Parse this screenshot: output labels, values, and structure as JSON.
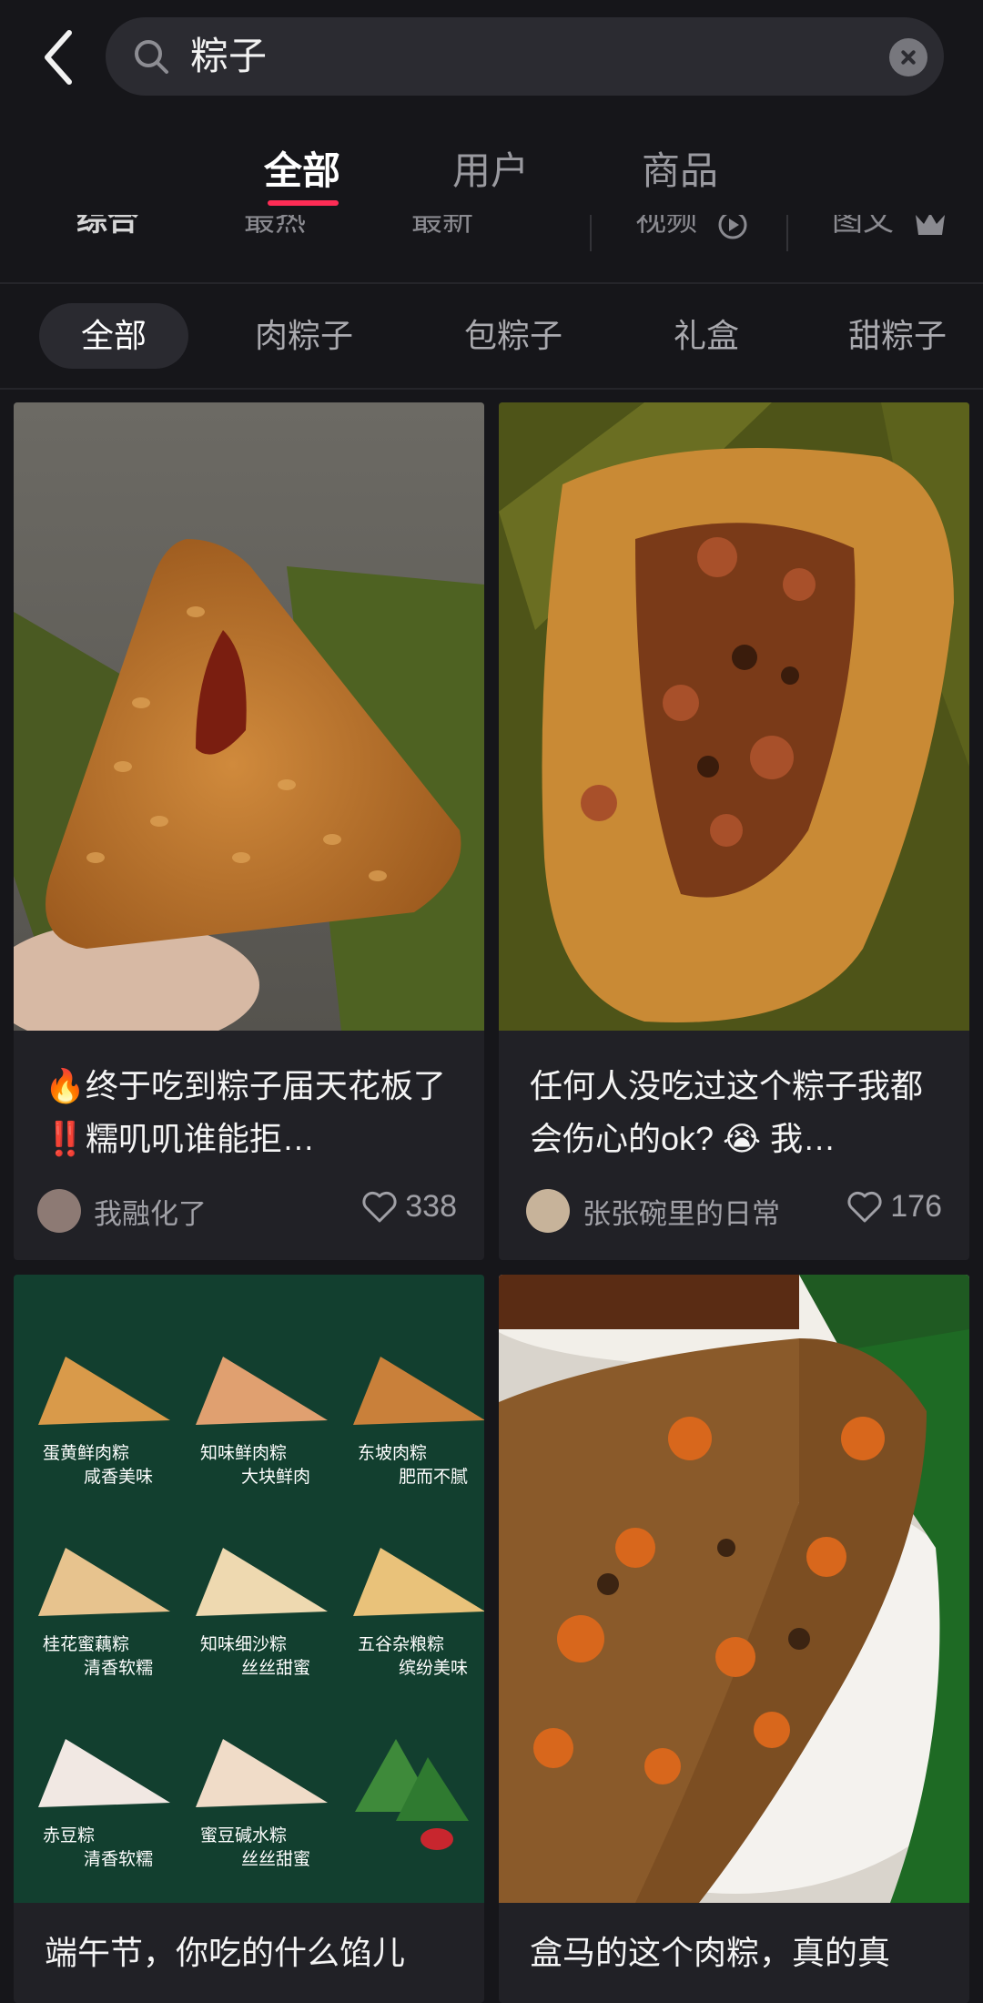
{
  "search": {
    "query": "粽子"
  },
  "tabs": [
    {
      "label": "全部",
      "active": true
    },
    {
      "label": "用户",
      "active": false
    },
    {
      "label": "商品",
      "active": false
    }
  ],
  "sort_options": [
    "综合",
    "最热",
    "最新",
    "视频",
    "图文"
  ],
  "filters": [
    "全部",
    "肉粽子",
    "包粽子",
    "礼盒",
    "甜粽子"
  ],
  "posts": [
    {
      "title": "🔥终于吃到粽子届天花板了 ‼️糯叽叽谁能拒…",
      "author": "我融化了",
      "likes": "338"
    },
    {
      "title": "任何人没吃过这个粽子我都会伤心的ok? 😭 我…",
      "author": "张张碗里的日常",
      "likes": "176"
    },
    {
      "title": "端午节，你吃的什么馅儿",
      "menu": [
        {
          "name": "蛋黄鲜肉粽",
          "desc": "咸香美味"
        },
        {
          "name": "知味鲜肉粽",
          "desc": "大块鲜肉"
        },
        {
          "name": "东坡肉粽",
          "desc": "肥而不腻"
        },
        {
          "name": "桂花蜜藕粽",
          "desc": "清香软糯"
        },
        {
          "name": "知味细沙粽",
          "desc": "丝丝甜蜜"
        },
        {
          "name": "五谷杂粮粽",
          "desc": "缤纷美味"
        },
        {
          "name": "赤豆粽",
          "desc": "清香软糯"
        },
        {
          "name": "蜜豆碱水粽",
          "desc": "丝丝甜蜜"
        }
      ]
    },
    {
      "title": "盒马的这个肉粽，真的真"
    }
  ],
  "colors": {
    "accent": "#fe2c55",
    "background": "#16161a",
    "card": "#212126"
  }
}
